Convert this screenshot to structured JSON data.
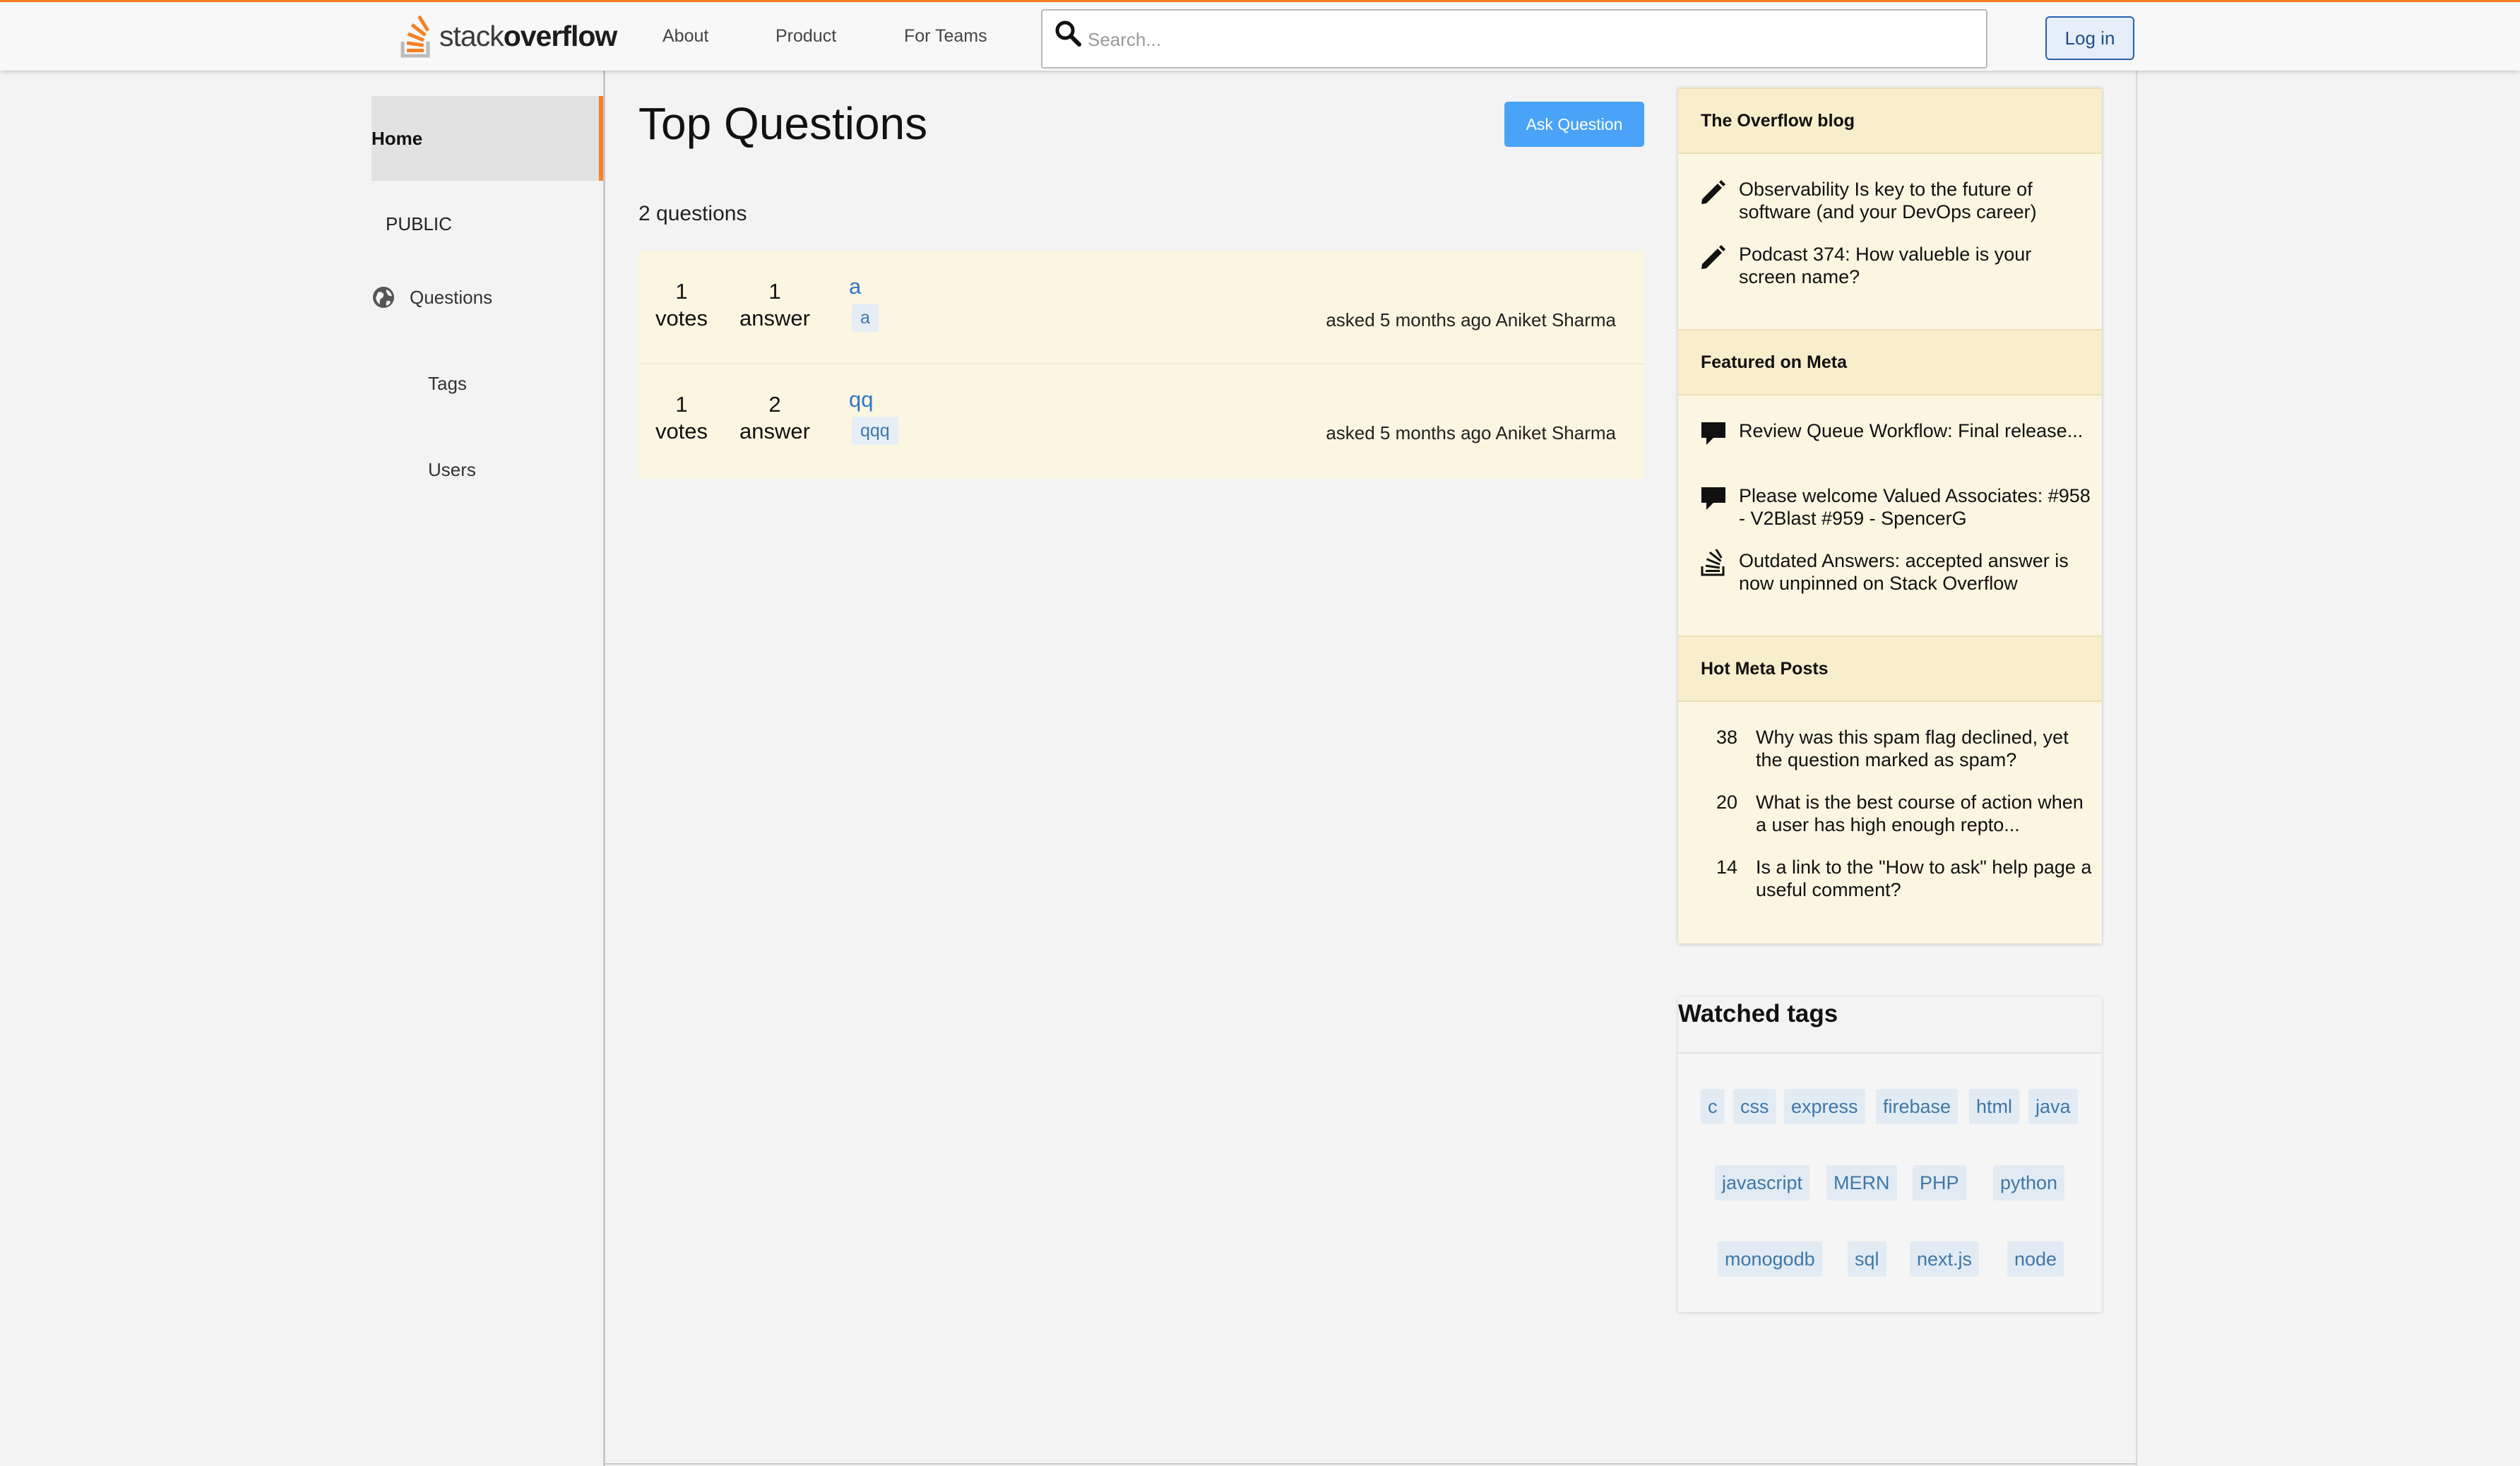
{
  "colors": {
    "accent": "#f48024",
    "link": "#2e78c7",
    "primary_button": "#4aa3f6",
    "widget_bg": "#fbf5e1"
  },
  "header": {
    "logo_light": "stack",
    "logo_bold": "overflow",
    "nav": [
      "About",
      "Product",
      "For Teams"
    ],
    "search_placeholder": "Search...",
    "search_icon": "search-icon",
    "login_label": "Log in"
  },
  "sidebar": {
    "home": "Home",
    "public": "PUBLIC",
    "questions": "Questions",
    "questions_icon": "globe-icon",
    "tags": "Tags",
    "users": "Users"
  },
  "main": {
    "title": "Top Questions",
    "ask_button": "Ask Question",
    "count_label": "2 questions",
    "questions": [
      {
        "votes": "1",
        "votes_label": "votes",
        "answers": "1",
        "answers_label": "answer",
        "title": "a",
        "tag": "a",
        "asked": "asked 5 months ago",
        "author": "Aniket Sharma"
      },
      {
        "votes": "1",
        "votes_label": "votes",
        "answers": "2",
        "answers_label": "answer",
        "title": "qq",
        "tag": "qqq",
        "asked": "asked 5 months ago",
        "author": "Aniket Sharma"
      }
    ]
  },
  "widget": {
    "blog_title": "The Overflow blog",
    "blog_items": [
      {
        "icon": "pencil-icon",
        "text": "Observability Is key to the future of software (and your DevOps career)"
      },
      {
        "icon": "pencil-icon",
        "text": "Podcast 374: How valueble is your screen name?"
      }
    ],
    "meta_title": "Featured on Meta",
    "meta_items": [
      {
        "icon": "comment-icon",
        "text": "Review Queue Workflow: Final release..."
      },
      {
        "icon": "comment-icon",
        "text": "Please welcome Valued Associates: #958 - V2Blast #959 - SpencerG"
      },
      {
        "icon": "stack-exchange-icon",
        "text": "Outdated Answers: accepted answer is now unpinned on Stack Overflow"
      }
    ],
    "hot_title": "Hot Meta Posts",
    "hot_items": [
      {
        "count": "38",
        "text": "Why was this spam flag declined, yet the question marked as spam?"
      },
      {
        "count": "20",
        "text": "What is the best course of action when a user has high enough repto..."
      },
      {
        "count": "14",
        "text": "Is a link to the \"How to ask\" help page a useful comment?"
      }
    ]
  },
  "watched": {
    "title": "Watched tags",
    "tags": [
      "c",
      "css",
      "express",
      "firebase",
      "html",
      "java",
      "javascript",
      "MERN",
      "PHP",
      "python",
      "monogodb",
      "sql",
      "next.js",
      "node"
    ]
  }
}
